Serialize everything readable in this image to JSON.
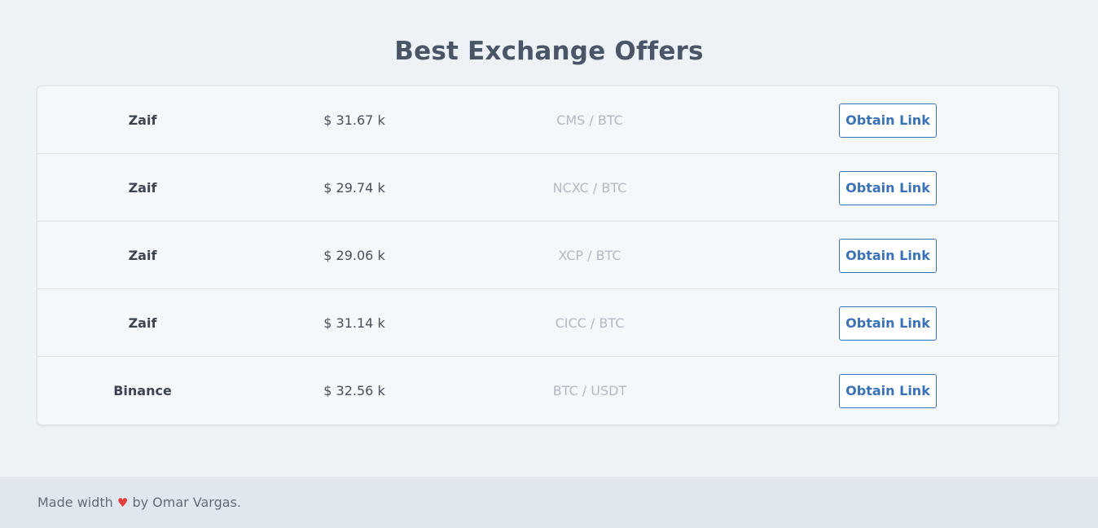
{
  "header": {
    "title": "Best Exchange Offers"
  },
  "offers": [
    {
      "exchange": "Zaif",
      "price": "$ 31.67 k",
      "pair": "CMS / BTC",
      "action_label": "Obtain Link"
    },
    {
      "exchange": "Zaif",
      "price": "$ 29.74 k",
      "pair": "NCXC / BTC",
      "action_label": "Obtain Link"
    },
    {
      "exchange": "Zaif",
      "price": "$ 29.06 k",
      "pair": "XCP / BTC",
      "action_label": "Obtain Link"
    },
    {
      "exchange": "Zaif",
      "price": "$ 31.14 k",
      "pair": "CICC / BTC",
      "action_label": "Obtain Link"
    },
    {
      "exchange": "Binance",
      "price": "$ 32.56 k",
      "pair": "BTC / USDT",
      "action_label": "Obtain Link"
    }
  ],
  "footer": {
    "prefix": "Made width",
    "icon": "heart-icon",
    "heart_glyph": "♥",
    "suffix": "by Omar Vargas."
  },
  "colors": {
    "background": "#edf2f6",
    "card": "#f4f8fb",
    "accent": "#3a72b8",
    "heart": "#e53e3e",
    "footer": "#e1e7ee"
  }
}
